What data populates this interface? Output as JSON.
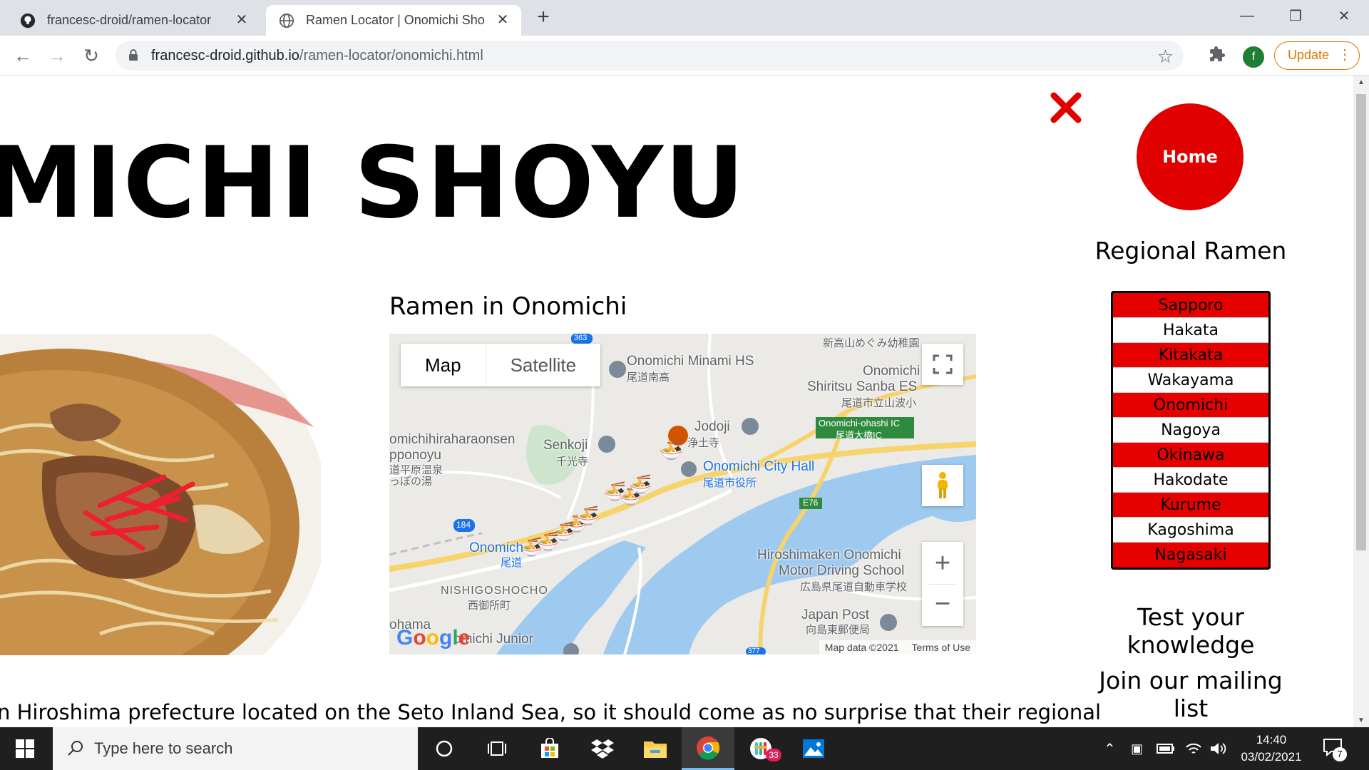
{
  "browser": {
    "tabs": [
      {
        "title": "francesc-droid/ramen-locator",
        "active": false
      },
      {
        "title": "Ramen Locator | Onomichi Shoyu",
        "active": true
      }
    ],
    "url_host": "francesc-droid.github.io",
    "url_path": "/ramen-locator/onomichi.html",
    "profile_initial": "f",
    "update_label": "Update"
  },
  "page": {
    "title": "MICHI SHOYU",
    "map_heading": "Ramen in Onomichi",
    "map": {
      "toggle_map": "Map",
      "toggle_satellite": "Satellite",
      "labels": [
        "Onomichi Minami HS",
        "尾道南高",
        "新高山めぐみ幼稚園",
        "Onomichi",
        "Shiritsu Sanba ES",
        "尾道市立山波小",
        "Onomichi-ohashi IC",
        "尾道大橋IC",
        "Jodoji",
        "浄土寺",
        "Senkoji",
        "千光寺",
        "omichihiraharaonsen",
        "pponoyu",
        "道平原温泉",
        "っぽの湯",
        "Onomichi City Hall",
        "尾道市役所",
        "Onomich",
        "尾道",
        "NISHIGOSHOCHO",
        "西御所町",
        "Hiroshimaken Onomichi",
        "Motor Driving School",
        "広島県尾道自動車学校",
        "Japan Post",
        "向島東郵便局",
        "ohama",
        "omichi Junior",
        "E76",
        "184",
        "363",
        "377"
      ],
      "google": "Google",
      "map_data": "Map data ©2021",
      "terms": "Terms of Use"
    },
    "intro": "n Hiroshima prefecture located on the Seto Inland Sea, so it should come as no surprise that their regional"
  },
  "sidenav": {
    "home": "Home",
    "regional_heading": "Regional Ramen",
    "regions": [
      "Sapporo",
      "Hakata",
      "Kitakata",
      "Wakayama",
      "Onomichi",
      "Nagoya",
      "Okinawa",
      "Hakodate",
      "Kurume",
      "Kagoshima",
      "Nagasaki"
    ],
    "quiz": "Test your knowledge",
    "mailing": "Join our mailing list"
  },
  "taskbar": {
    "search_placeholder": "Type here to search",
    "time": "14:40",
    "date": "03/02/2021",
    "notifications": "7",
    "slack_badge": "33"
  },
  "colors": {
    "accent_red": "#e00000",
    "chrome_update": "#e37400"
  }
}
